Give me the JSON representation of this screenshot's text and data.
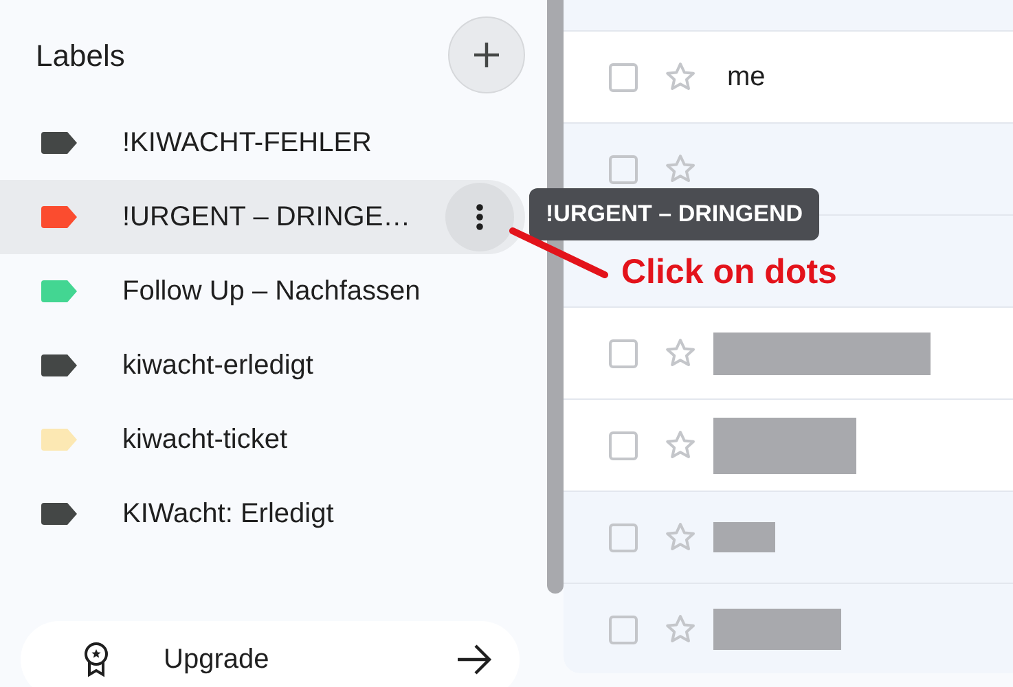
{
  "sidebar": {
    "heading": "Labels",
    "labels": [
      {
        "name": "!KIWACHT-FEHLER",
        "color": "#444746",
        "hovered": false
      },
      {
        "name": "!URGENT – DRINGE…",
        "color": "#fb4c2f",
        "hovered": true
      },
      {
        "name": "Follow Up – Nachfassen",
        "color": "#43d692",
        "hovered": false
      },
      {
        "name": "kiwacht-erledigt",
        "color": "#444746",
        "hovered": false
      },
      {
        "name": "kiwacht-ticket",
        "color": "#fce8b3",
        "hovered": false
      },
      {
        "name": "KIWacht: Erledigt",
        "color": "#444746",
        "hovered": false
      }
    ],
    "upgrade": {
      "label": "Upgrade"
    }
  },
  "tooltip": "!URGENT – DRINGEND",
  "annotation": "Click on dots",
  "emails": [
    {
      "kind": "empty",
      "read": true
    },
    {
      "kind": "sender",
      "sender": "me",
      "read": false
    },
    {
      "kind": "empty",
      "read": true
    },
    {
      "kind": "covered",
      "read": true
    },
    {
      "kind": "redacted",
      "read": false
    },
    {
      "kind": "redacted",
      "read": false
    },
    {
      "kind": "redacted",
      "read": true
    },
    {
      "kind": "redacted",
      "read": true
    }
  ]
}
